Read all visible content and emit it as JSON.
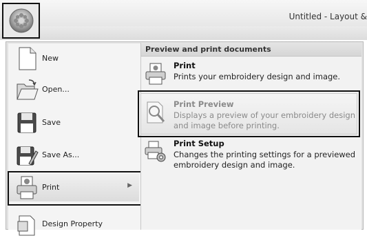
{
  "window": {
    "title": "Untitled - Layout &"
  },
  "app_button": {
    "icon": "app-orb-icon"
  },
  "left_menu": {
    "items": [
      {
        "name": "new",
        "label": "New",
        "icon": "new-document-icon"
      },
      {
        "name": "open",
        "label": "Open...",
        "icon": "open-folder-icon"
      },
      {
        "name": "save",
        "label": "Save",
        "icon": "save-disk-icon"
      },
      {
        "name": "save-as",
        "label": "Save As...",
        "icon": "save-as-icon"
      },
      {
        "name": "print",
        "label": "Print",
        "icon": "printer-icon"
      },
      {
        "name": "design-property",
        "label": "Design Property",
        "icon": "design-property-icon"
      }
    ]
  },
  "right_panel": {
    "header": "Preview and print documents",
    "items": [
      {
        "title": "Print",
        "description": "Prints your embroidery design and image.",
        "icon": "printer-icon"
      },
      {
        "title": "Print Preview",
        "description": "Displays a preview of your embroidery design and image before printing.",
        "icon": "print-preview-icon"
      },
      {
        "title": "Print Setup",
        "description": "Changes the printing settings for a previewed embroidery design and image.",
        "icon": "print-setup-icon"
      }
    ]
  }
}
